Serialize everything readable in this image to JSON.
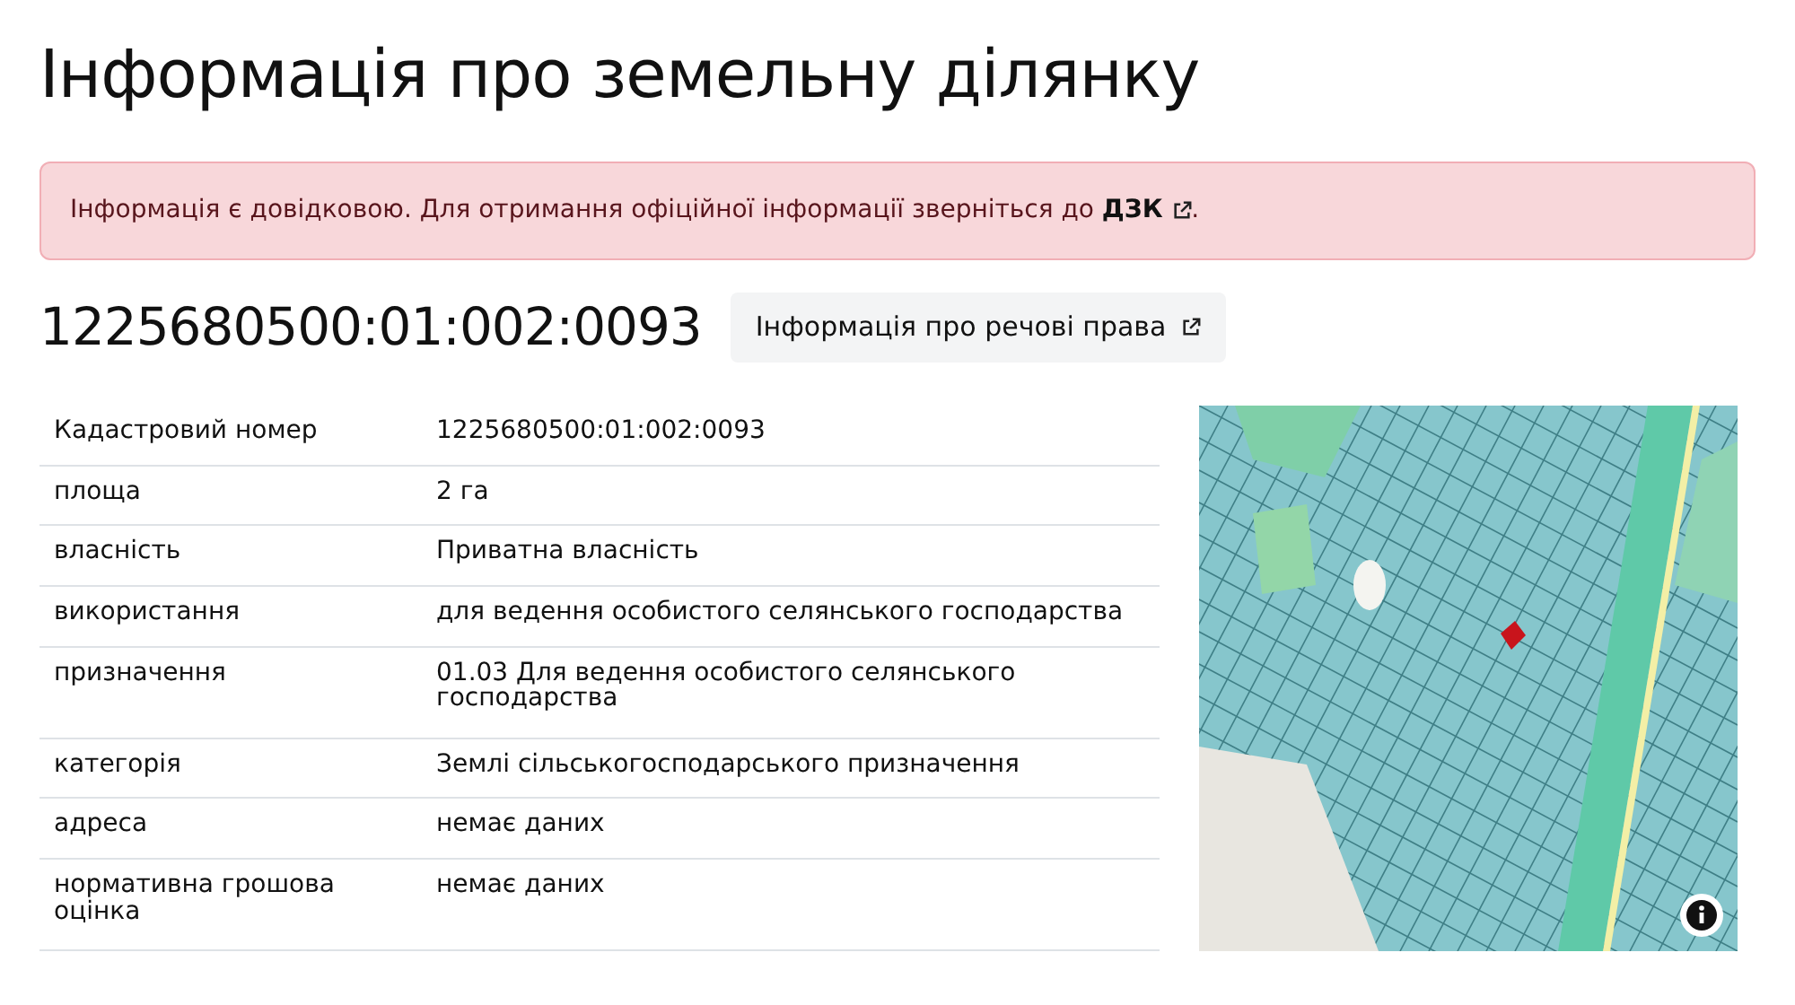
{
  "title": "Інформація про земельну ділянку",
  "alert": {
    "text": "Інформація є довідковою. Для отримання офіційної інформації зверніться до ",
    "link": "ДЗК",
    "end": "."
  },
  "parcel": {
    "number": "1225680500:01:002:0093",
    "rights_button": "Інформація про речові права"
  },
  "table": {
    "rows": [
      {
        "label": "Кадастровий номер",
        "value": "1225680500:01:002:0093"
      },
      {
        "label": "площа",
        "value": "2 га"
      },
      {
        "label": "власність",
        "value": "Приватна власність"
      },
      {
        "label": "використання",
        "value": "для ведення особистого селянського господарства"
      },
      {
        "label": "призначення",
        "value": "01.03 Для ведення особистого селянського господарства"
      },
      {
        "label": "категорія",
        "value": "Землі сільськогосподарського призначення"
      },
      {
        "label": "адреса",
        "value": "немає даних"
      },
      {
        "label": "нормативна грошова оцінка",
        "value": "немає даних"
      }
    ]
  }
}
